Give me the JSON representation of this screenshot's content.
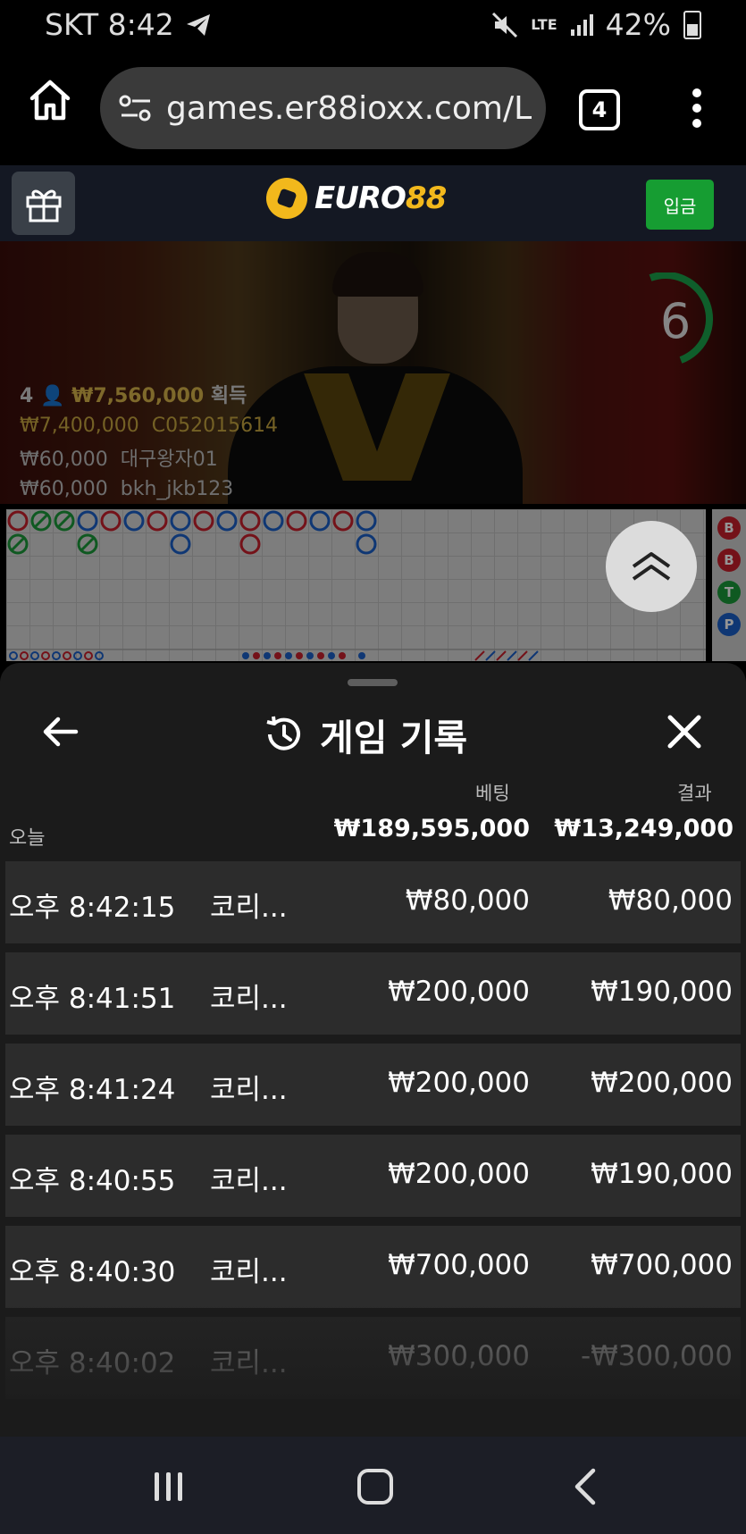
{
  "status_bar": {
    "carrier_time": "SKT 8:42",
    "telegram_icon": "telegram-icon",
    "network": "LTE",
    "battery": "42%"
  },
  "browser": {
    "url": "games.er88ioxx.com/L",
    "tab_count": "4"
  },
  "site_header": {
    "logo_text_a": "EURO",
    "logo_text_b": "88",
    "deposit_label": "입금",
    "accent": "#169d32"
  },
  "live_video": {
    "timer": "6",
    "winners_head": {
      "count": "4",
      "amount": "₩7,560,000",
      "suffix": "획득"
    },
    "winners": [
      {
        "amount": "₩7,400,000",
        "name": "C052015614"
      },
      {
        "amount": "₩60,000",
        "name": "대구왕자01"
      },
      {
        "amount": "₩60,000",
        "name": "bkh_jkb123"
      }
    ],
    "side_labels": [
      "B",
      "B",
      "T",
      "P"
    ]
  },
  "history_sheet": {
    "title": "게임 기록",
    "col_bet": "베팅",
    "col_result": "결과",
    "today_label": "오늘",
    "total_bet": "₩189,595,000",
    "total_result": "₩13,249,000",
    "rows": [
      {
        "time": "오후 8:42:15",
        "game": "코리...",
        "bet": "₩80,000",
        "result": "₩80,000"
      },
      {
        "time": "오후 8:41:51",
        "game": "코리...",
        "bet": "₩200,000",
        "result": "₩190,000"
      },
      {
        "time": "오후 8:41:24",
        "game": "코리...",
        "bet": "₩200,000",
        "result": "₩200,000"
      },
      {
        "time": "오후 8:40:55",
        "game": "코리...",
        "bet": "₩200,000",
        "result": "₩190,000"
      },
      {
        "time": "오후 8:40:30",
        "game": "코리...",
        "bet": "₩700,000",
        "result": "₩700,000"
      },
      {
        "time": "오후 8:40:02",
        "game": "코리...",
        "bet": "₩300,000",
        "result": "-₩300,000"
      }
    ]
  }
}
